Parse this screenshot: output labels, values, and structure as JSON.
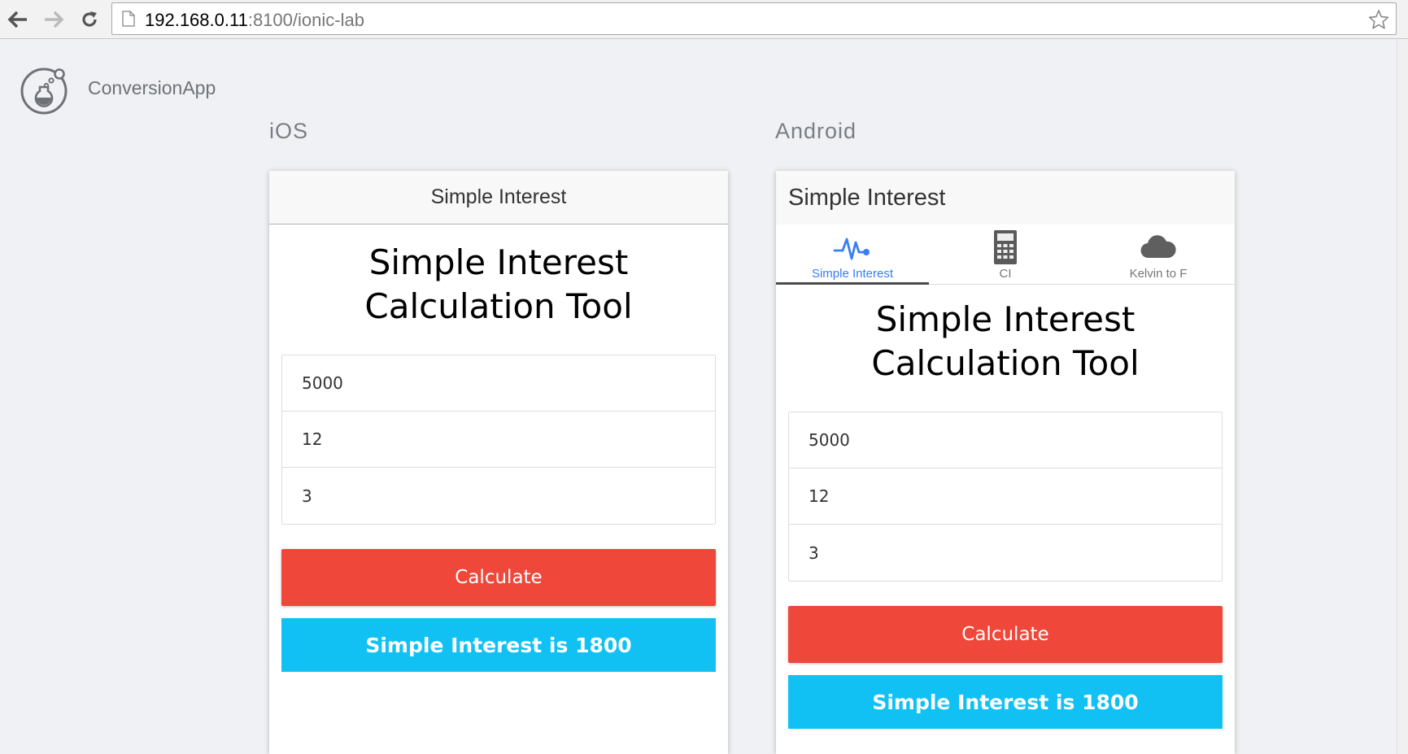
{
  "browser": {
    "url_host": "192.168.0.11",
    "url_rest": ":8100/ionic-lab"
  },
  "lab": {
    "app_name": "ConversionApp",
    "platforms": [
      {
        "label": "iOS"
      },
      {
        "label": "Android"
      }
    ]
  },
  "ios": {
    "toolbar_title": "Simple Interest",
    "heading": "Simple Interest Calculation Tool",
    "fields": [
      "5000",
      "12",
      "3"
    ],
    "calculate_label": "Calculate",
    "result": "Simple Interest is 1800"
  },
  "android": {
    "toolbar_title": "Simple Interest",
    "tabs": [
      {
        "label": "Simple Interest",
        "icon": "pulse-icon",
        "active": true
      },
      {
        "label": "CI",
        "icon": "calculator-icon",
        "active": false
      },
      {
        "label": "Kelvin to F",
        "icon": "cloud-icon",
        "active": false
      }
    ],
    "heading": "Simple Interest Calculation Tool",
    "fields": [
      "5000",
      "12",
      "3"
    ],
    "calculate_label": "Calculate",
    "result": "Simple Interest is 1800"
  },
  "colors": {
    "calculate": "#ef473a",
    "result": "#11c1f3",
    "active_tab": "#387ef5"
  }
}
